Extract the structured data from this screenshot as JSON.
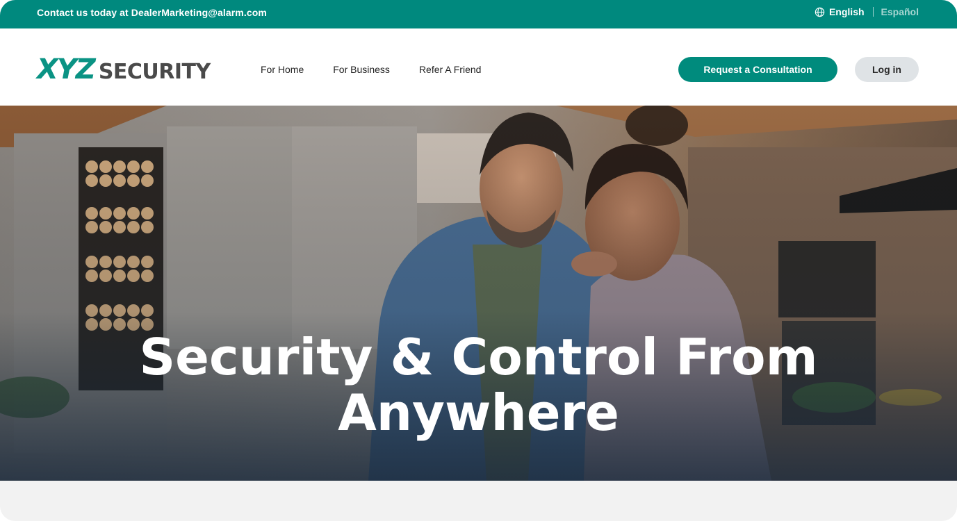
{
  "topbar": {
    "contact_text": "Contact us today at DealerMarketing@alarm.com",
    "lang_active": "English",
    "lang_inactive": "Español",
    "globe_icon": "globe-icon"
  },
  "header": {
    "logo_xyz": "XYZ",
    "logo_security": "SECURITY",
    "nav": [
      {
        "label": "For Home"
      },
      {
        "label": "For Business"
      },
      {
        "label": "Refer A Friend"
      }
    ],
    "cta_label": "Request a Consultation",
    "login_label": "Log in"
  },
  "hero": {
    "title_line1": "Security & Control From",
    "title_line2": "Anywhere"
  },
  "colors": {
    "brand_teal": "#00897e",
    "button_teal": "#008b7d",
    "login_bg": "#dfe3e6"
  }
}
